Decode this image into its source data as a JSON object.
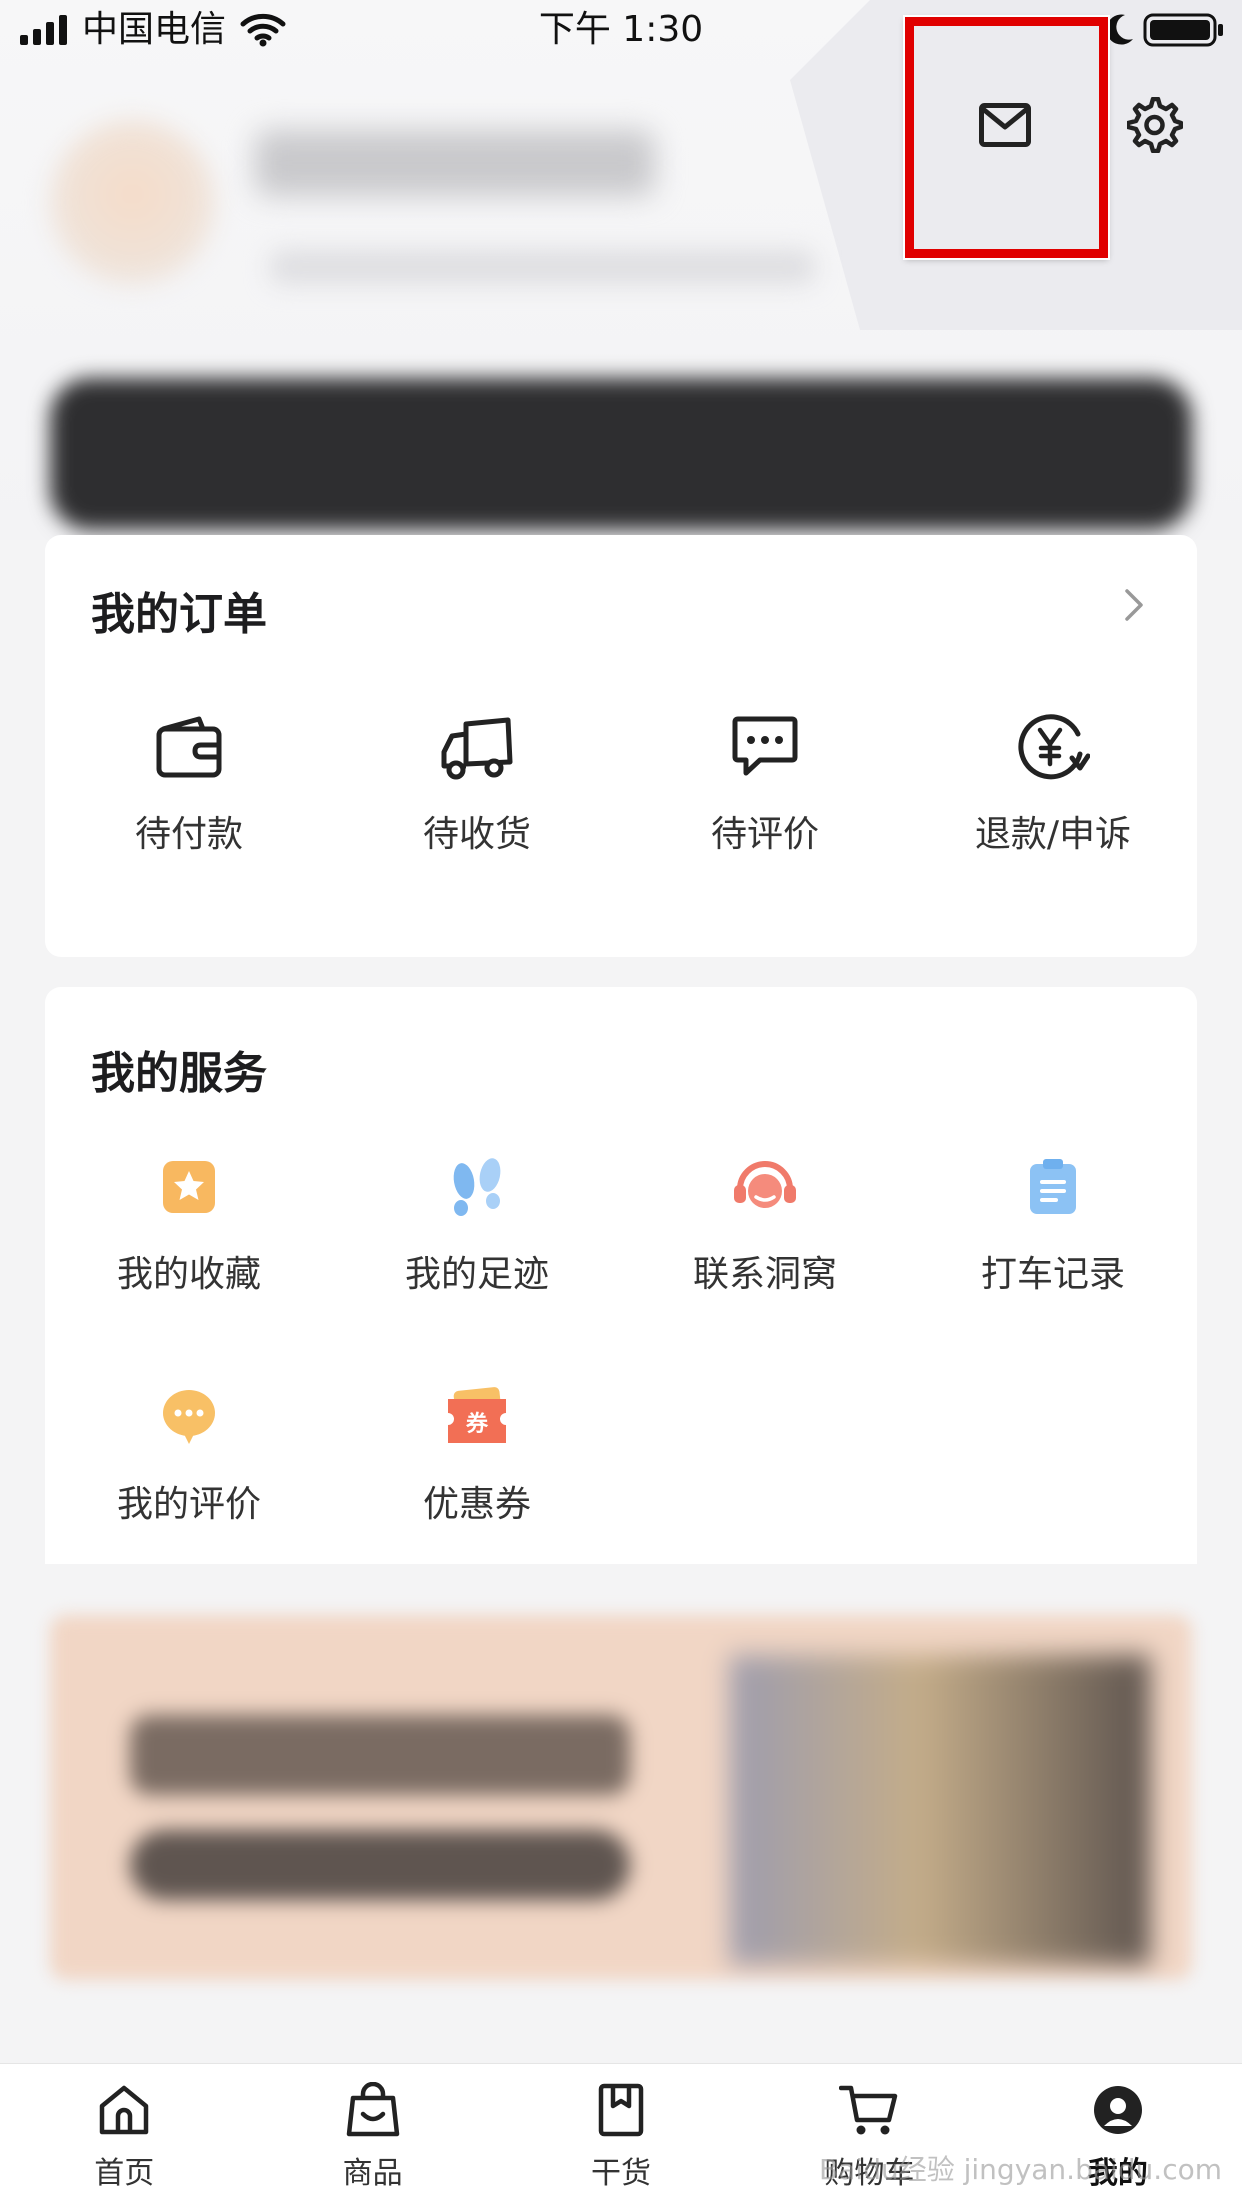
{
  "status_bar": {
    "carrier": "中国电信",
    "time": "下午 1:30"
  },
  "orders": {
    "title": "我的订单",
    "items": [
      {
        "label": "待付款",
        "icon": "wallet-icon"
      },
      {
        "label": "待收货",
        "icon": "delivery-truck-icon"
      },
      {
        "label": "待评价",
        "icon": "comment-icon"
      },
      {
        "label": "退款/申诉",
        "icon": "refund-icon"
      }
    ]
  },
  "services": {
    "title": "我的服务",
    "items": [
      {
        "label": "我的收藏",
        "icon": "favorite-star-icon",
        "color": "#f8b860"
      },
      {
        "label": "我的足迹",
        "icon": "footprints-icon",
        "color": "#7fb8f0"
      },
      {
        "label": "联系洞窝",
        "icon": "customer-service-icon",
        "color": "#f07a6a"
      },
      {
        "label": "打车记录",
        "icon": "clipboard-icon",
        "color": "#7fb8f0"
      },
      {
        "label": "我的评价",
        "icon": "review-bubble-icon",
        "color": "#f8b860"
      },
      {
        "label": "优惠券",
        "icon": "coupon-icon",
        "color": "#f07a6a"
      }
    ]
  },
  "tabbar": {
    "items": [
      {
        "label": "首页",
        "icon": "home-icon"
      },
      {
        "label": "商品",
        "icon": "shopping-bag-icon"
      },
      {
        "label": "干货",
        "icon": "bookmark-book-icon"
      },
      {
        "label": "购物车",
        "icon": "cart-icon"
      },
      {
        "label": "我的",
        "icon": "profile-icon"
      }
    ],
    "active": "我的"
  },
  "watermark": "Baidu经验 jingyan.baidu.com",
  "colors": {
    "highlight": "#e00000",
    "background": "#f4f4f5"
  }
}
